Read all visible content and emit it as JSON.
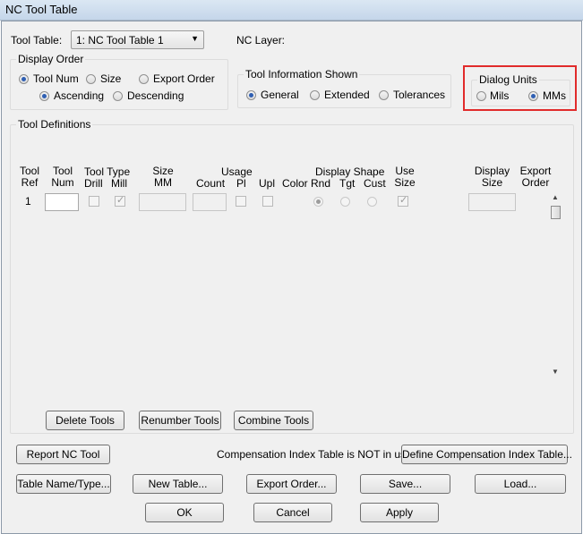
{
  "title": "NC Tool Table",
  "tool_table": {
    "label": "Tool Table:",
    "selected": "1: NC Tool Table 1",
    "nc_layer_label": "NC Layer:"
  },
  "display_order": {
    "title": "Display Order",
    "options": [
      "Tool Num",
      "Size",
      "Export Order"
    ],
    "selected": "Tool Num",
    "sort_options": [
      "Ascending",
      "Descending"
    ],
    "sort_selected": "Ascending"
  },
  "tool_info": {
    "title": "Tool Information Shown",
    "options": [
      "General",
      "Extended",
      "Tolerances"
    ],
    "selected": "General"
  },
  "dialog_units": {
    "title": "Dialog Units",
    "options": [
      "Mils",
      "MMs"
    ],
    "selected": "MMs",
    "highlight_color": "#e12b2b"
  },
  "tool_definitions": {
    "title": "Tool Definitions",
    "headers": {
      "tool_ref": [
        "Tool",
        "Ref"
      ],
      "tool_num": [
        "Tool",
        "Num"
      ],
      "tool_type": "Tool Type",
      "drill": "Drill",
      "mill": "Mill",
      "size": [
        "Size",
        "MM"
      ],
      "usage": "Usage",
      "count": "Count",
      "pl": "Pl",
      "upl": "Upl",
      "color": "Color",
      "display_shape": "Display Shape",
      "rnd": "Rnd",
      "tgt": "Tgt",
      "cust": "Cust",
      "use_size": [
        "Use",
        "Size"
      ],
      "display_size": [
        "Display",
        "Size"
      ],
      "export_order": [
        "Export",
        "Order"
      ]
    },
    "rows": [
      {
        "ref": "1",
        "num": "",
        "drill": false,
        "mill": true,
        "size": "",
        "count": "",
        "pl": false,
        "upl": false,
        "shape": "Rnd",
        "use_size": true,
        "display_size": ""
      }
    ],
    "buttons": {
      "delete": "Delete Tools",
      "renumber": "Renumber Tools",
      "combine": "Combine Tools"
    }
  },
  "report": {
    "button": "Report NC Tool",
    "compensation_text": "Compensation Index Table is NOT in use:",
    "define_button": "Define Compensation Index Table..."
  },
  "bottom_buttons": {
    "table_name": "Table Name/Type...",
    "new_table": "New Table...",
    "export_order": "Export Order...",
    "save": "Save...",
    "load": "Load...",
    "ok": "OK",
    "cancel": "Cancel",
    "apply": "Apply"
  },
  "icons": {
    "dropdown": "chevron-down-icon",
    "scroll_up": "scroll-up-arrow-icon",
    "scroll_down": "scroll-down-arrow-icon"
  }
}
